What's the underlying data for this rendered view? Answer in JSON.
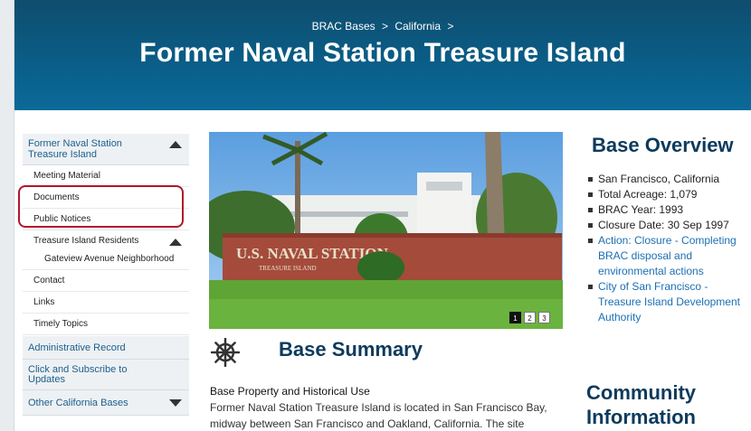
{
  "breadcrumb": {
    "item1": "BRAC Bases",
    "sep1": ">",
    "item2": "California",
    "sep2": ">"
  },
  "page_title": "Former Naval Station Treasure Island",
  "sidebar": {
    "section_title": "Former Naval Station Treasure Island",
    "sub_items": [
      "Meeting Material",
      "Documents",
      "Public Notices"
    ],
    "residents": "Treasure Island Residents",
    "neighborhood": "Gateview Avenue Neighborhood",
    "contact": "Contact",
    "links": "Links",
    "timely": "Timely Topics",
    "admin_record": "Administrative Record",
    "subscribe": "Click and Subscribe to Updates",
    "other_bases": "Other California Bases"
  },
  "slideshow": {
    "pages": [
      "1",
      "2",
      "3"
    ],
    "active": 1
  },
  "photo_sign": {
    "line1": "U.S. NAVAL STATION",
    "line2": "TREASURE ISLAND"
  },
  "summary": {
    "title": "Base Summary",
    "heading": "Base Property and Historical Use",
    "text": "Former Naval Station Treasure Island is located in San Francisco Bay, midway between San Francisco and Oakland, California. The site"
  },
  "overview": {
    "title": "Base Overview",
    "items": [
      "San Francisco, California",
      "Total Acreage: 1,079",
      "BRAC Year: 1993",
      "Closure Date: 30 Sep 1997"
    ],
    "links": [
      "Action: Closure - Completing BRAC disposal and environmental actions",
      "City of San Francisco - Treasure Island Development Authority"
    ]
  },
  "community_title": "Community Information",
  "colors": {
    "header": "#0a5d86",
    "link": "#1b6fb3",
    "title": "#0d3a5c",
    "highlight": "#b3162b"
  }
}
